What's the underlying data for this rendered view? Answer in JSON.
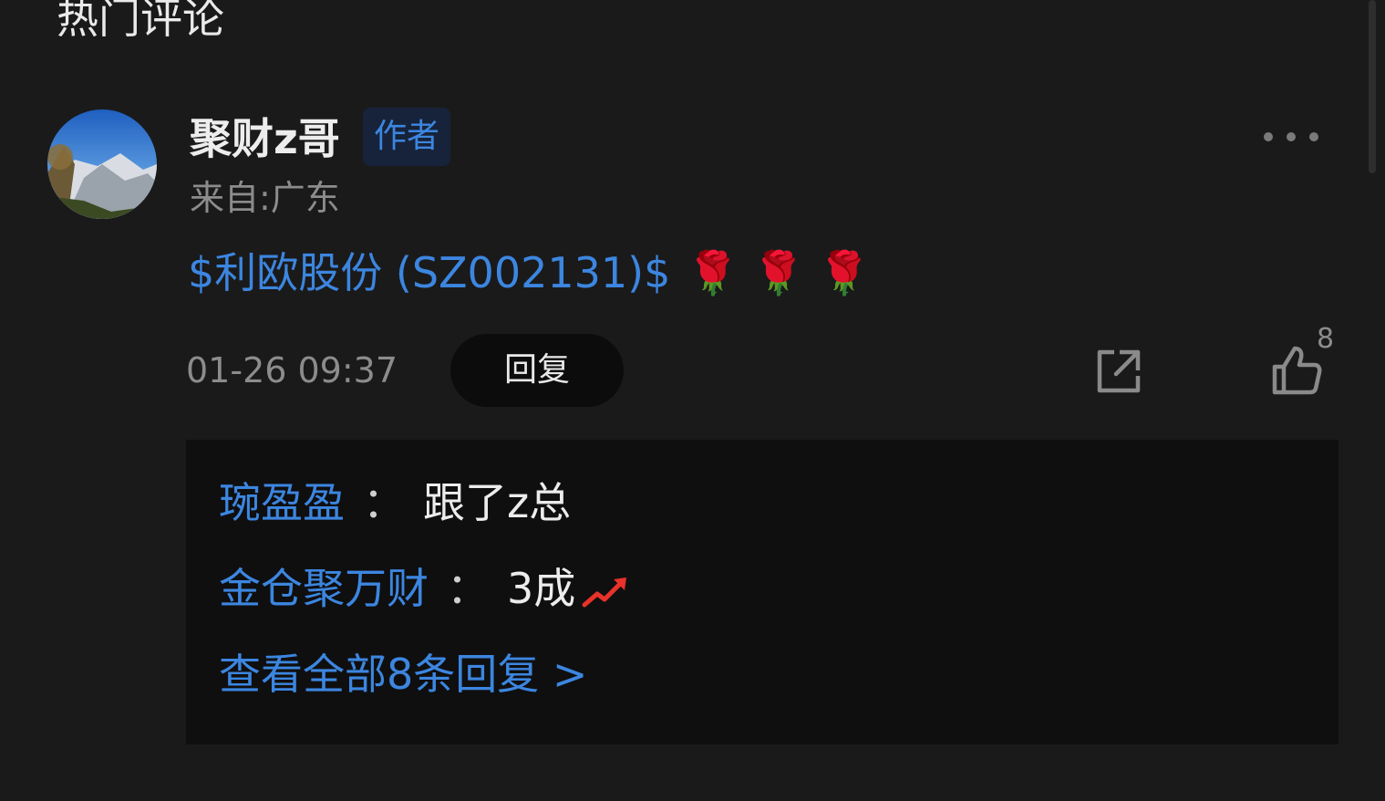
{
  "section": {
    "title": "热门评论"
  },
  "comment": {
    "username": "聚财z哥",
    "badge": "作者",
    "location": "来自:广东",
    "stock_link": "$利欧股份 (SZ002131)$",
    "emojis": "🌹 🌹 🌹",
    "timestamp": "01-26 09:37",
    "reply_label": "回复",
    "like_count": "8"
  },
  "replies": [
    {
      "user": "琬盈盈",
      "sep": "：",
      "text": "跟了z总"
    },
    {
      "user": "金仓聚万财",
      "sep": "：",
      "text": "3成"
    }
  ],
  "view_all": "查看全部8条回复 >",
  "icons": {
    "more": "more-icon",
    "share": "share-icon",
    "like": "thumbs-up-icon",
    "rise": "trending-up-icon"
  },
  "colors": {
    "background": "#1a1a1b",
    "link": "#3c86e0",
    "muted": "#8c8c8c",
    "reply_box": "#0f0f10"
  }
}
